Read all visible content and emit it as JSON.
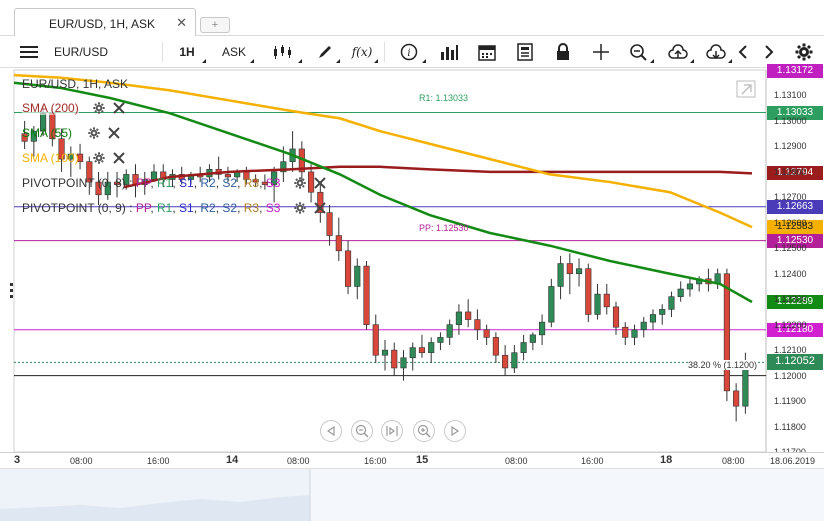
{
  "tab": {
    "title": "EUR/USD, 1H, ASK",
    "add_label": "+"
  },
  "toolbar": {
    "symbol": "EUR/USD",
    "timeframe": "1H",
    "price_side": "ASK",
    "fx_label": "f(x)"
  },
  "legend": {
    "title": "EUR/USD, 1H, ASK",
    "sma200": "SMA (200)",
    "sma55": "SMA (55)",
    "sma100": "SMA (100)",
    "pivot1_name": "PIVOTPOINT (0, 8)",
    "pivot2_name": "PIVOTPOINT (0, 9)",
    "pivot_items": [
      "PP",
      "R1",
      "S1",
      "R2",
      "S2",
      "R3",
      "S3"
    ]
  },
  "annotations": {
    "r1": "R1: 1.13033",
    "pp": "PP: 1.12530",
    "fib": "38.20 % (1.1200)"
  },
  "price_labels": [
    {
      "value": "1.13172",
      "color": "#c020c0"
    },
    {
      "value": "1.13033",
      "color": "#2e9e60"
    },
    {
      "value": "1.12794",
      "color": "#9b1c1c"
    },
    {
      "value": "1.12663",
      "color": "#4a3cb8"
    },
    {
      "value": "1.12583",
      "color": "#f5b000"
    },
    {
      "value": "1.12530",
      "color": "#b4209a"
    },
    {
      "value": "1.12289",
      "color": "#138a13"
    },
    {
      "value": "1.12180",
      "color": "#d020d0"
    },
    {
      "value": "1.12052",
      "color": "#2e8a57"
    }
  ],
  "y_ticks": [
    "1.13100",
    "1.13000",
    "1.12900",
    "1.12800",
    "1.12700",
    "1.12600",
    "1.12500",
    "1.12400",
    "1.12300",
    "1.12200",
    "1.12100",
    "1.12000",
    "1.11900",
    "1.11800",
    "1.11700"
  ],
  "x_ticks": [
    {
      "label": "3",
      "bold": true
    },
    {
      "label": "08:00",
      "bold": false
    },
    {
      "label": "16:00",
      "bold": false
    },
    {
      "label": "14",
      "bold": true
    },
    {
      "label": "08:00",
      "bold": false
    },
    {
      "label": "16:00",
      "bold": false
    },
    {
      "label": "15",
      "bold": true
    },
    {
      "label": "08:00",
      "bold": false
    },
    {
      "label": "16:00",
      "bold": false
    },
    {
      "label": "18",
      "bold": true
    },
    {
      "label": "08:00",
      "bold": false
    },
    {
      "label": "18.06.2019",
      "bold": false
    }
  ],
  "colors": {
    "sma200": "#9b1c1c",
    "sma55": "#138a13",
    "sma100": "#f5b000",
    "bull": "#2e8a57",
    "bear": "#d9473b",
    "r1_line": "#2e9e60",
    "pp_line": "#b4209a",
    "pivot_blue": "#4a3cb8",
    "pivot_magenta": "#d020d0",
    "accent": "#c020c0"
  },
  "chart_data": {
    "type": "candlestick",
    "title": "EUR/USD, 1H, ASK",
    "ylim": [
      1.117,
      1.132
    ],
    "candles": [
      [
        1.1295,
        1.13,
        1.1289,
        1.1292
      ],
      [
        1.1292,
        1.1298,
        1.1286,
        1.1296
      ],
      [
        1.1296,
        1.1306,
        1.1294,
        1.1303
      ],
      [
        1.1303,
        1.1305,
        1.129,
        1.1293
      ],
      [
        1.1293,
        1.1297,
        1.128,
        1.1285
      ],
      [
        1.1285,
        1.129,
        1.1278,
        1.1287
      ],
      [
        1.1287,
        1.1291,
        1.1281,
        1.1284
      ],
      [
        1.1284,
        1.1286,
        1.1271,
        1.1276
      ],
      [
        1.1276,
        1.128,
        1.1267,
        1.1271
      ],
      [
        1.1271,
        1.128,
        1.1269,
        1.1276
      ],
      [
        1.1276,
        1.128,
        1.127,
        1.1275
      ],
      [
        1.1275,
        1.1281,
        1.1273,
        1.1279
      ],
      [
        1.1279,
        1.1283,
        1.127,
        1.1275
      ],
      [
        1.1275,
        1.128,
        1.1271,
        1.1277
      ],
      [
        1.1277,
        1.1283,
        1.1276,
        1.128
      ],
      [
        1.128,
        1.1283,
        1.1274,
        1.1277
      ],
      [
        1.1277,
        1.1281,
        1.1274,
        1.1279
      ],
      [
        1.1279,
        1.1282,
        1.1275,
        1.1277
      ],
      [
        1.1277,
        1.128,
        1.1275,
        1.1279
      ],
      [
        1.1279,
        1.1282,
        1.1276,
        1.1278
      ],
      [
        1.1278,
        1.1283,
        1.1276,
        1.1281
      ],
      [
        1.1281,
        1.1286,
        1.1277,
        1.1279
      ],
      [
        1.1279,
        1.1282,
        1.1276,
        1.1278
      ],
      [
        1.1278,
        1.1281,
        1.1276,
        1.128
      ],
      [
        1.128,
        1.1282,
        1.1275,
        1.1277
      ],
      [
        1.1277,
        1.1279,
        1.1274,
        1.1276
      ],
      [
        1.1276,
        1.1279,
        1.1273,
        1.1275
      ],
      [
        1.1275,
        1.1282,
        1.1268,
        1.128
      ],
      [
        1.128,
        1.129,
        1.1276,
        1.1284
      ],
      [
        1.1284,
        1.1296,
        1.128,
        1.1289
      ],
      [
        1.1289,
        1.1292,
        1.1276,
        1.128
      ],
      [
        1.128,
        1.1283,
        1.1268,
        1.1272
      ],
      [
        1.1272,
        1.1275,
        1.126,
        1.1264
      ],
      [
        1.1264,
        1.1267,
        1.1251,
        1.1255
      ],
      [
        1.1255,
        1.1262,
        1.1245,
        1.1249
      ],
      [
        1.1249,
        1.1253,
        1.1232,
        1.1235
      ],
      [
        1.1235,
        1.1246,
        1.123,
        1.1243
      ],
      [
        1.1243,
        1.1245,
        1.1218,
        1.122
      ],
      [
        1.122,
        1.1224,
        1.1205,
        1.1208
      ],
      [
        1.1208,
        1.1214,
        1.1202,
        1.121
      ],
      [
        1.121,
        1.1213,
        1.12,
        1.1203
      ],
      [
        1.1203,
        1.121,
        1.1198,
        1.1207
      ],
      [
        1.1207,
        1.1213,
        1.1202,
        1.1211
      ],
      [
        1.1211,
        1.1216,
        1.1207,
        1.1209
      ],
      [
        1.1209,
        1.1215,
        1.1205,
        1.1213
      ],
      [
        1.1213,
        1.1217,
        1.121,
        1.1215
      ],
      [
        1.1215,
        1.1222,
        1.1212,
        1.122
      ],
      [
        1.122,
        1.1228,
        1.1216,
        1.1225
      ],
      [
        1.1225,
        1.123,
        1.1219,
        1.1222
      ],
      [
        1.1222,
        1.1226,
        1.1214,
        1.1218
      ],
      [
        1.1218,
        1.122,
        1.1212,
        1.1215
      ],
      [
        1.1215,
        1.1217,
        1.1205,
        1.1208
      ],
      [
        1.1208,
        1.1212,
        1.12,
        1.1203
      ],
      [
        1.1203,
        1.1212,
        1.1201,
        1.1209
      ],
      [
        1.1209,
        1.1216,
        1.1206,
        1.1213
      ],
      [
        1.1213,
        1.1217,
        1.121,
        1.1216
      ],
      [
        1.1216,
        1.1224,
        1.1212,
        1.1221
      ],
      [
        1.1221,
        1.1238,
        1.1219,
        1.1235
      ],
      [
        1.1235,
        1.1247,
        1.123,
        1.1244
      ],
      [
        1.1244,
        1.1248,
        1.1232,
        1.124
      ],
      [
        1.124,
        1.1246,
        1.1235,
        1.1242
      ],
      [
        1.1242,
        1.1244,
        1.1221,
        1.1224
      ],
      [
        1.1224,
        1.1236,
        1.1222,
        1.1232
      ],
      [
        1.1232,
        1.1236,
        1.1224,
        1.1227
      ],
      [
        1.1227,
        1.1229,
        1.1216,
        1.1219
      ],
      [
        1.1219,
        1.1221,
        1.1212,
        1.1215
      ],
      [
        1.1215,
        1.122,
        1.1212,
        1.1218
      ],
      [
        1.1218,
        1.1223,
        1.1215,
        1.1221
      ],
      [
        1.1221,
        1.1226,
        1.1218,
        1.1224
      ],
      [
        1.1224,
        1.1228,
        1.122,
        1.1226
      ],
      [
        1.1226,
        1.1233,
        1.1223,
        1.1231
      ],
      [
        1.1231,
        1.1237,
        1.1229,
        1.1234
      ],
      [
        1.1234,
        1.1238,
        1.1231,
        1.1236
      ],
      [
        1.1236,
        1.1239,
        1.1233,
        1.1238
      ],
      [
        1.1238,
        1.1242,
        1.1233,
        1.1236
      ],
      [
        1.1236,
        1.1242,
        1.1234,
        1.124
      ],
      [
        1.124,
        1.1242,
        1.119,
        1.1194
      ],
      [
        1.1194,
        1.1197,
        1.1182,
        1.1188
      ],
      [
        1.1188,
        1.1209,
        1.1185,
        1.1205
      ]
    ]
  }
}
